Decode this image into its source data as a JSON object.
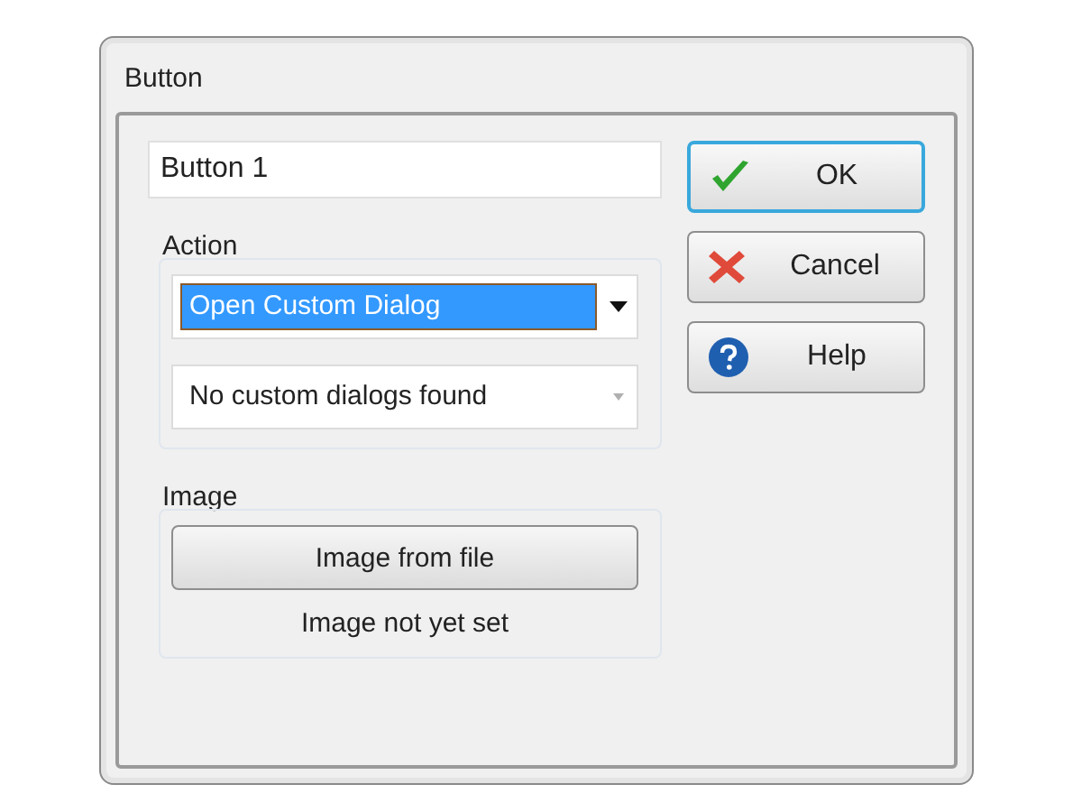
{
  "window": {
    "title": "Button"
  },
  "name_field": {
    "value": "Button 1"
  },
  "action_group": {
    "label": "Action",
    "dropdowns": [
      {
        "value": "Open Custom Dialog",
        "highlighted": true,
        "disabled": false
      },
      {
        "value": "No custom dialogs found",
        "highlighted": false,
        "disabled": true
      }
    ]
  },
  "image_group": {
    "label": "Image",
    "button": "Image from file",
    "status": "Image not yet set"
  },
  "buttons": [
    {
      "label": "OK",
      "kind": "ok",
      "default": true
    },
    {
      "label": "Cancel",
      "kind": "cancel",
      "default": false
    },
    {
      "label": "Help",
      "kind": "help",
      "default": false
    }
  ]
}
